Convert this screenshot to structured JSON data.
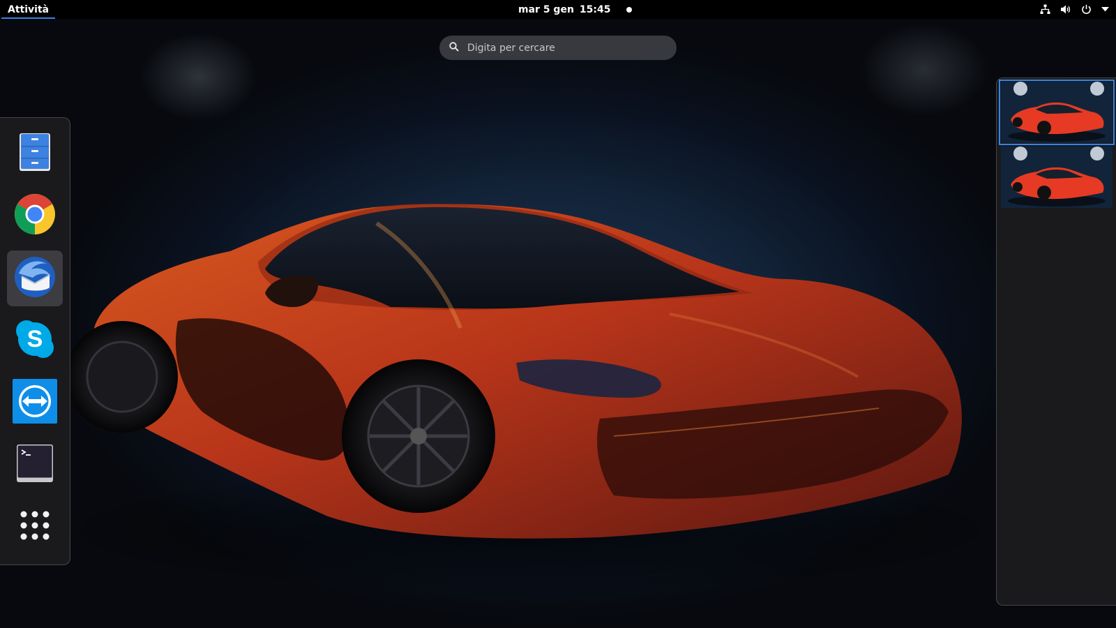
{
  "top_bar": {
    "activities_label": "Attività",
    "date": "mar 5 gen",
    "time": "15:45",
    "tray_icons": [
      "network-icon",
      "volume-icon",
      "power-icon",
      "system-menu-arrow-icon"
    ]
  },
  "search": {
    "placeholder": "Digita per cercare"
  },
  "dash": {
    "apps": [
      {
        "name": "files",
        "icon": "file-cabinet-icon",
        "active": false
      },
      {
        "name": "chrome",
        "icon": "chrome-icon",
        "active": false
      },
      {
        "name": "thunderbird",
        "icon": "thunderbird-icon",
        "active": true
      },
      {
        "name": "skype",
        "icon": "skype-icon",
        "active": false
      },
      {
        "name": "teamviewer",
        "icon": "teamviewer-icon",
        "active": false
      },
      {
        "name": "terminal",
        "icon": "terminal-icon",
        "active": false
      },
      {
        "name": "show-applications",
        "icon": "app-grid-icon",
        "active": false
      }
    ]
  },
  "workspaces": {
    "count": 2,
    "active_index": 0
  },
  "colors": {
    "accent": "#3584e4",
    "top_bar": "#000000",
    "car_orange": "#c8441c"
  }
}
